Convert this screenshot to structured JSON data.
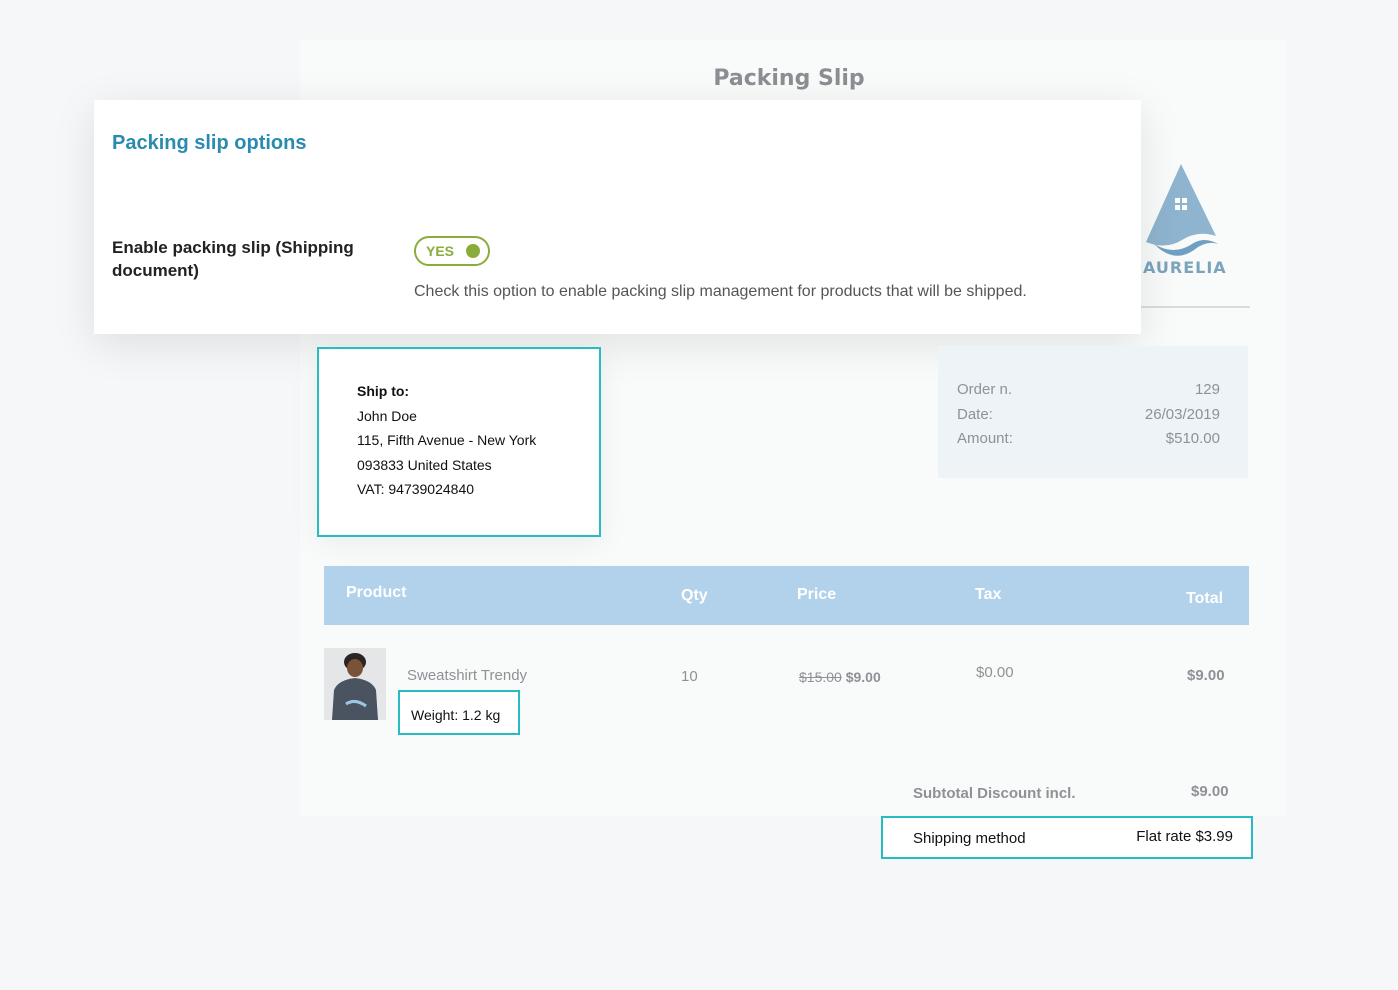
{
  "document": {
    "title": "Packing Slip",
    "logo_text": "AURELIA"
  },
  "options": {
    "title": "Packing slip options",
    "enable_label": "Enable packing slip (Shipping document)",
    "toggle_label": "YES",
    "toggle_on": true,
    "description": "Check this option to enable packing slip management for products that will be shipped."
  },
  "ship_to": {
    "heading": "Ship to:",
    "name": "John Doe",
    "address": "115, Fifth Avenue - New York",
    "postal": "093833 United States",
    "vat": "VAT: 94739024840"
  },
  "order": {
    "number_label": "Order n.",
    "number": "129",
    "date_label": "Date:",
    "date": "26/03/2019",
    "amount_label": "Amount:",
    "amount": "$510.00"
  },
  "table": {
    "headers": {
      "product": "Product",
      "qty": "Qty",
      "price": "Price",
      "tax": "Tax",
      "total": "Total"
    },
    "row": {
      "product": "Sweatshirt Trendy",
      "weight": "Weight: 1.2 kg",
      "qty": "10",
      "old_price": "$15.00",
      "price": "$9.00",
      "tax": "$0.00",
      "total": "$9.00"
    }
  },
  "totals": {
    "subtotal_label": "Subtotal Discount incl.",
    "subtotal": "$9.00",
    "shipping_label": "Shipping method",
    "shipping_value": "Flat rate $3.99"
  },
  "colors": {
    "accent": "#2a8bb0",
    "toggle": "#8aac3b",
    "highlight_border": "#27bcc4",
    "table_header": "#b2d2ec"
  }
}
